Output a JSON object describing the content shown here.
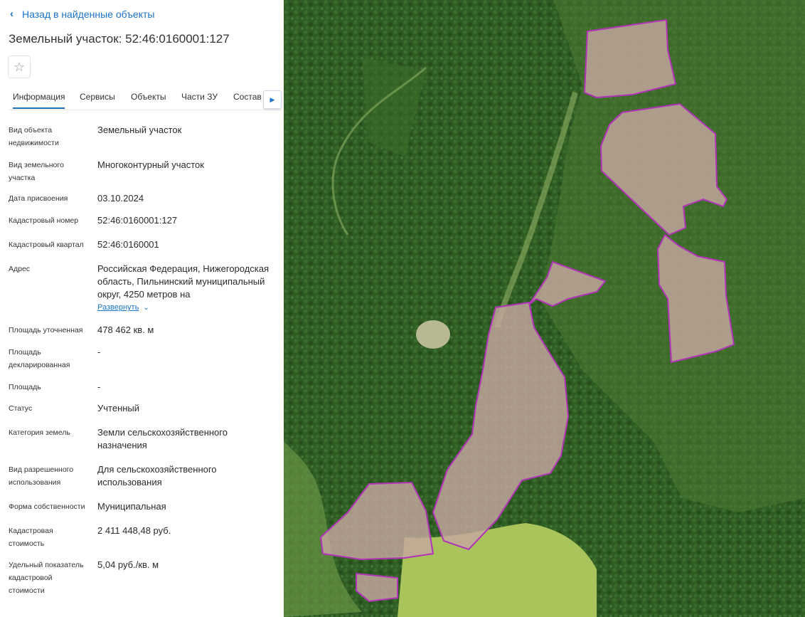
{
  "nav": {
    "back_label": "Назад в найденные объекты"
  },
  "header": {
    "title": "Земельный участок: 52:46:0160001:127"
  },
  "favorite": {
    "icon": "star-outline-icon"
  },
  "tabs": [
    {
      "label": "Информация",
      "active": true
    },
    {
      "label": "Сервисы",
      "active": false
    },
    {
      "label": "Объекты",
      "active": false
    },
    {
      "label": "Части ЗУ",
      "active": false
    },
    {
      "label": "Состав",
      "active": false
    }
  ],
  "tab_scroll": {
    "icon": "arrow-right-icon"
  },
  "info": {
    "kind_label": "Вид объекта недвижимости",
    "kind_value": "Земельный участок",
    "land_kind_label": "Вид земельного участка",
    "land_kind_value": "Многоконтурный участок",
    "date_label": "Дата присвоения",
    "date_value": "03.10.2024",
    "cad_num_label": "Кадастровый номер",
    "cad_num_value": "52:46:0160001:127",
    "cad_block_label": "Кадастровый квартал",
    "cad_block_value": "52:46:0160001",
    "address_label": "Адрес",
    "address_value": "Российская Федерация, Нижегородская область, Пильнинский муниципальный округ, 4250 метров на",
    "expand_label": "Развернуть",
    "area_precise_label": "Площадь уточненная",
    "area_precise_value": "478 462 кв. м",
    "area_declared_label": "Площадь декларированная",
    "area_declared_value": "-",
    "area_label": "Площадь",
    "area_value": "-",
    "status_label": "Статус",
    "status_value": "Учтенный",
    "category_label": "Категория земель",
    "category_value": "Земли сельскохозяйственного назначения",
    "usage_label": "Вид разрешенного использования",
    "usage_value": "Для сельскохозяйственного использования",
    "ownership_label": "Форма собственности",
    "ownership_value": "Муниципальная",
    "cad_cost_label": "Кадастровая стоимость",
    "cad_cost_value": "2 411 448,48 руб.",
    "specific_label": "Удельный показатель кадастровой стоимости",
    "specific_value": "5,04 руб./кв. м"
  },
  "map": {
    "colors": {
      "forest": "#2e5a22",
      "meadow": "#6f9a45",
      "field": "#a9c45a",
      "parcel_fill": "#c9a7a0",
      "parcel_stroke": "#b233b8"
    }
  }
}
